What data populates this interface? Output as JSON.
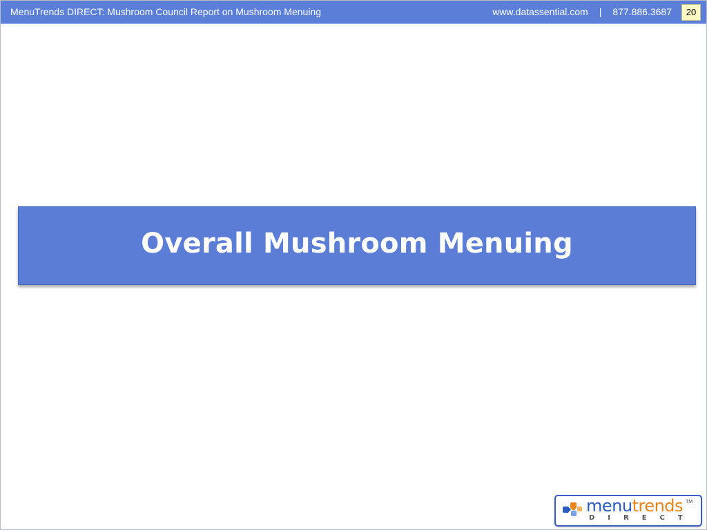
{
  "header": {
    "title": "MenuTrends DIRECT: Mushroom Council Report on Mushroom Menuing",
    "website": "www.datassential.com",
    "separator": "|",
    "phone": "877.886.3687",
    "page_number": "20"
  },
  "slide": {
    "section_title": "Overall Mushroom Menuing"
  },
  "logo": {
    "word_part1": "menu",
    "word_part2": "trends",
    "trademark": "TM",
    "subtext": "DIRECT",
    "icon": "puzzle-pieces-icon"
  },
  "colors": {
    "header_bar": "#5b7fd8",
    "title_band": "#5b7dd6",
    "logo_blue": "#2c5bbf",
    "logo_orange": "#e8851c",
    "page_box": "#fff9c4"
  }
}
